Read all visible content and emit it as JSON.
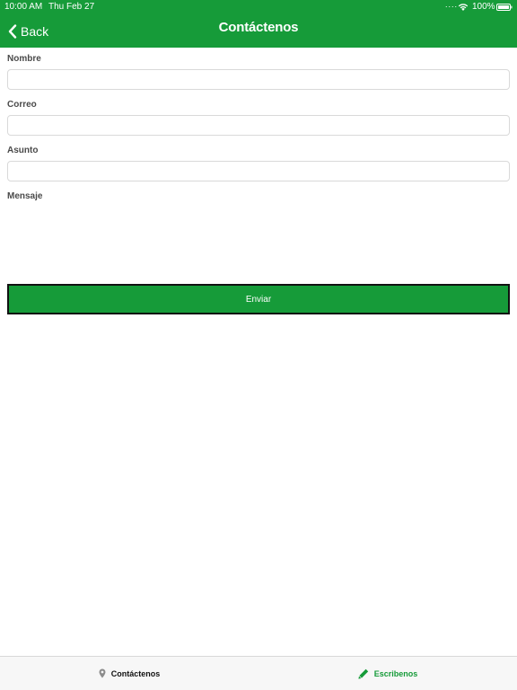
{
  "status_bar": {
    "time": "10:00 AM",
    "date": "Thu Feb 27",
    "signal": "....",
    "battery": "100%"
  },
  "nav": {
    "back_label": "Back",
    "title": "Contáctenos"
  },
  "form": {
    "fields": [
      {
        "label": "Nombre",
        "value": ""
      },
      {
        "label": "Correo",
        "value": ""
      },
      {
        "label": "Asunto",
        "value": ""
      }
    ],
    "message_label": "Mensaje",
    "message_value": "",
    "submit_label": "Enviar"
  },
  "tabbar": {
    "tabs": [
      {
        "label": "Contáctenos",
        "icon": "location-pin-icon"
      },
      {
        "label": "Escribenos",
        "icon": "pencil-icon",
        "active": true
      }
    ]
  },
  "colors": {
    "accent": "#169b39",
    "tab_inactive": "#111111"
  }
}
